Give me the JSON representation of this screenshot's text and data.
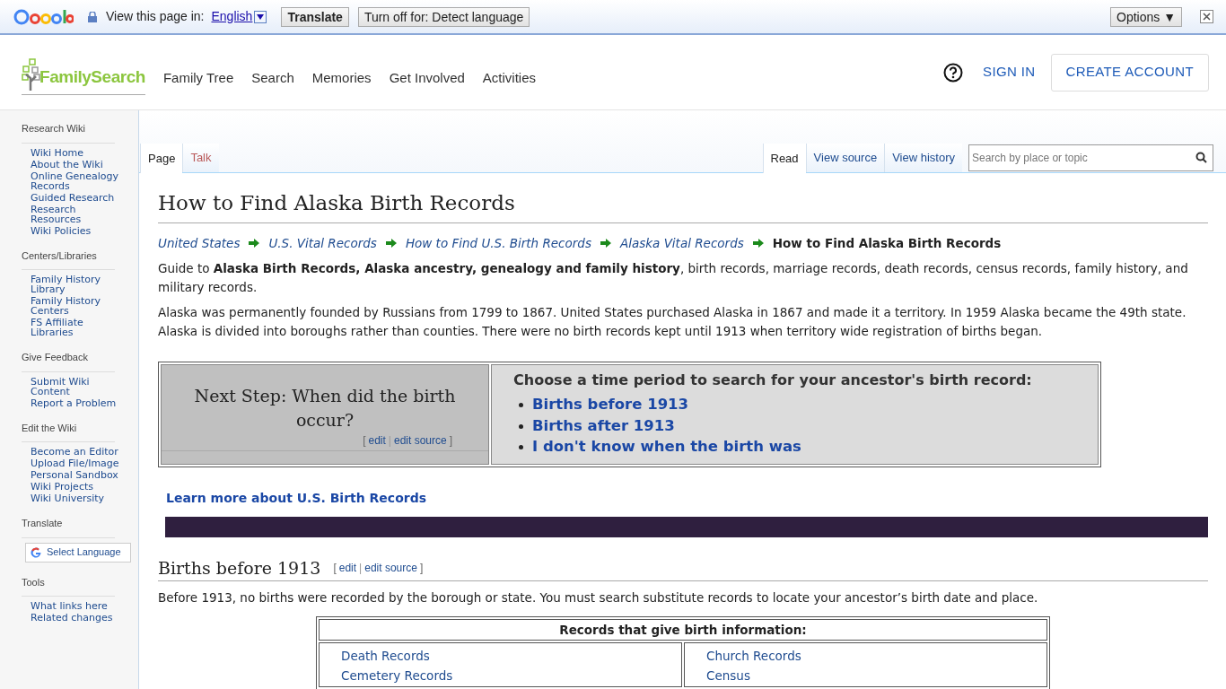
{
  "translate_bar": {
    "view_label": "View this page in:",
    "language": "English",
    "translate_button": "Translate",
    "turn_off_button": "Turn off for: Detect language",
    "options_button": "Options ▼"
  },
  "header": {
    "logo": "FamilySearch",
    "nav": [
      "Family Tree",
      "Search",
      "Memories",
      "Get Involved",
      "Activities"
    ],
    "sign_in": "SIGN IN",
    "create_account": "CREATE ACCOUNT"
  },
  "sidebar": [
    {
      "heading": "Research Wiki",
      "items": [
        "Wiki Home",
        "About the Wiki",
        "Online Genealogy Records",
        "Guided Research",
        "Research Resources",
        "Wiki Policies"
      ]
    },
    {
      "heading": "Centers/Libraries",
      "items": [
        "Family History Library",
        "Family History Centers",
        "FS Affiliate Libraries"
      ]
    },
    {
      "heading": "Give Feedback",
      "items": [
        "Submit Wiki Content",
        "Report a Problem"
      ]
    },
    {
      "heading": "Edit the Wiki",
      "items": [
        "Become an Editor",
        "Upload File/Image",
        "Personal Sandbox",
        "Wiki Projects",
        "Wiki University"
      ]
    },
    {
      "heading": "Translate",
      "widget": "Select Language"
    },
    {
      "heading": "Tools",
      "items": [
        "What links here",
        "Related changes"
      ]
    }
  ],
  "page_tabs": [
    {
      "label": "Page",
      "selected": true,
      "missing": false
    },
    {
      "label": "Talk",
      "selected": false,
      "missing": true
    }
  ],
  "view_tabs": [
    {
      "label": "Read",
      "selected": true
    },
    {
      "label": "View source",
      "selected": false
    },
    {
      "label": "View history",
      "selected": false
    }
  ],
  "search": {
    "placeholder": "Search by place or topic"
  },
  "article": {
    "title": "How to Find Alaska Birth Records",
    "breadcrumb": [
      "United States",
      "U.S. Vital Records",
      "How to Find U.S. Birth Records",
      "Alaska Vital Records"
    ],
    "breadcrumb_current": "How to Find Alaska Birth Records",
    "paragraphs": [
      "Guide to **Alaska Birth Records, Alaska ancestry, genealogy and family history**, birth records, marriage records, death records, census records, family history, and military records.",
      "Alaska was permanently founded by Russians from 1799 to 1867. United States purchased Alaska in 1867 and made it a territory. In 1959 Alaska became the 49th state. Alaska is divided into boroughs rather than counties. There were no birth records kept until 1913 when territory wide registration of births began."
    ],
    "next_step": {
      "title": "Next Step: When did the birth occur?",
      "edit_links": [
        "[",
        "edit",
        "|",
        "edit source",
        "]"
      ],
      "heading": "Choose a time period to search for your ancestor's birth record:",
      "links": [
        "Births before 1913",
        "Births after 1913",
        "I don't know when the birth was"
      ]
    },
    "learn_more": "Learn more about U.S. Birth Records",
    "section": {
      "heading": "Births before 1913",
      "edit_links": [
        "[",
        "edit",
        "|",
        "edit source",
        "]"
      ],
      "text": "Before 1913, no births were recorded by the borough or state. You must search substitute records to locate your ancestor’s birth date and place.",
      "table": {
        "header": "Records that give birth information:",
        "columns": [
          [
            "Death Records",
            "Cemetery Records"
          ],
          [
            "Church Records",
            "Census"
          ]
        ]
      }
    }
  }
}
